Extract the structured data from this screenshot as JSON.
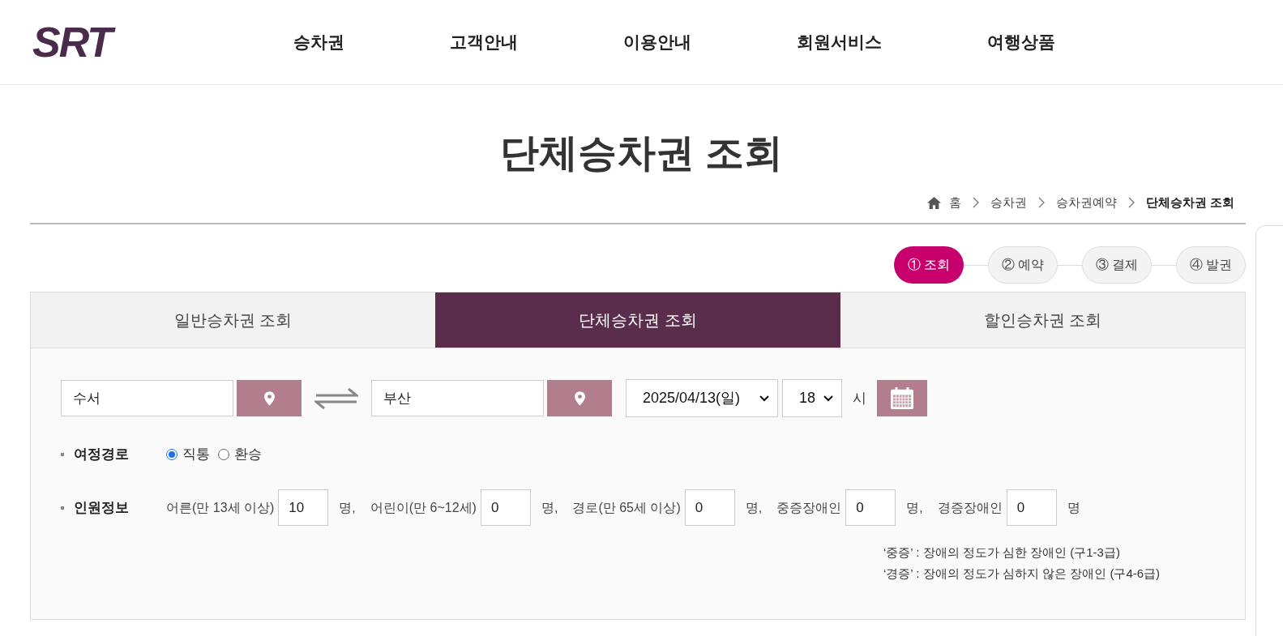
{
  "header": {
    "logo": "SRT",
    "nav": [
      "승차권",
      "고객안내",
      "이용안내",
      "회원서비스",
      "여행상품"
    ]
  },
  "page_title": "단체승차권 조회",
  "breadcrumb": [
    "홈",
    "승차권",
    "승차권예약",
    "단체승차권 조회"
  ],
  "steps": [
    {
      "label": "① 조회",
      "selected": true
    },
    {
      "label": "② 예약",
      "selected": false
    },
    {
      "label": "③ 결제",
      "selected": false
    },
    {
      "label": "④ 발권",
      "selected": false
    }
  ],
  "tabs": [
    {
      "label": "일반승차권 조회",
      "selected": false
    },
    {
      "label": "단체승차권 조회",
      "selected": true
    },
    {
      "label": "할인승차권 조회",
      "selected": false
    }
  ],
  "search": {
    "departure": "수서",
    "arrival": "부산",
    "date": "2025/04/13(일)",
    "hour": "18",
    "hour_unit": "시"
  },
  "route": {
    "label": "여정경로",
    "options": [
      {
        "label": "직통",
        "selected": true
      },
      {
        "label": "환승",
        "selected": false
      }
    ]
  },
  "passengers": {
    "label": "인원정보",
    "items": [
      {
        "label": "어른(만 13세 이상)",
        "value": "10",
        "unit": "명,"
      },
      {
        "label": "어린이(만 6~12세)",
        "value": "0",
        "unit": "명,"
      },
      {
        "label": "경로(만 65세 이상)",
        "value": "0",
        "unit": "명,"
      },
      {
        "label": "중증장애인",
        "value": "0",
        "unit": "명,"
      },
      {
        "label": "경증장애인",
        "value": "0",
        "unit": "명"
      }
    ]
  },
  "notes": [
    "‘중증’ : 장애의 정도가 심한 장애인 (구1-3급)",
    "‘경증’ : 장애의 정도가 심하지 않은 장애인 (구4-6급)"
  ]
}
